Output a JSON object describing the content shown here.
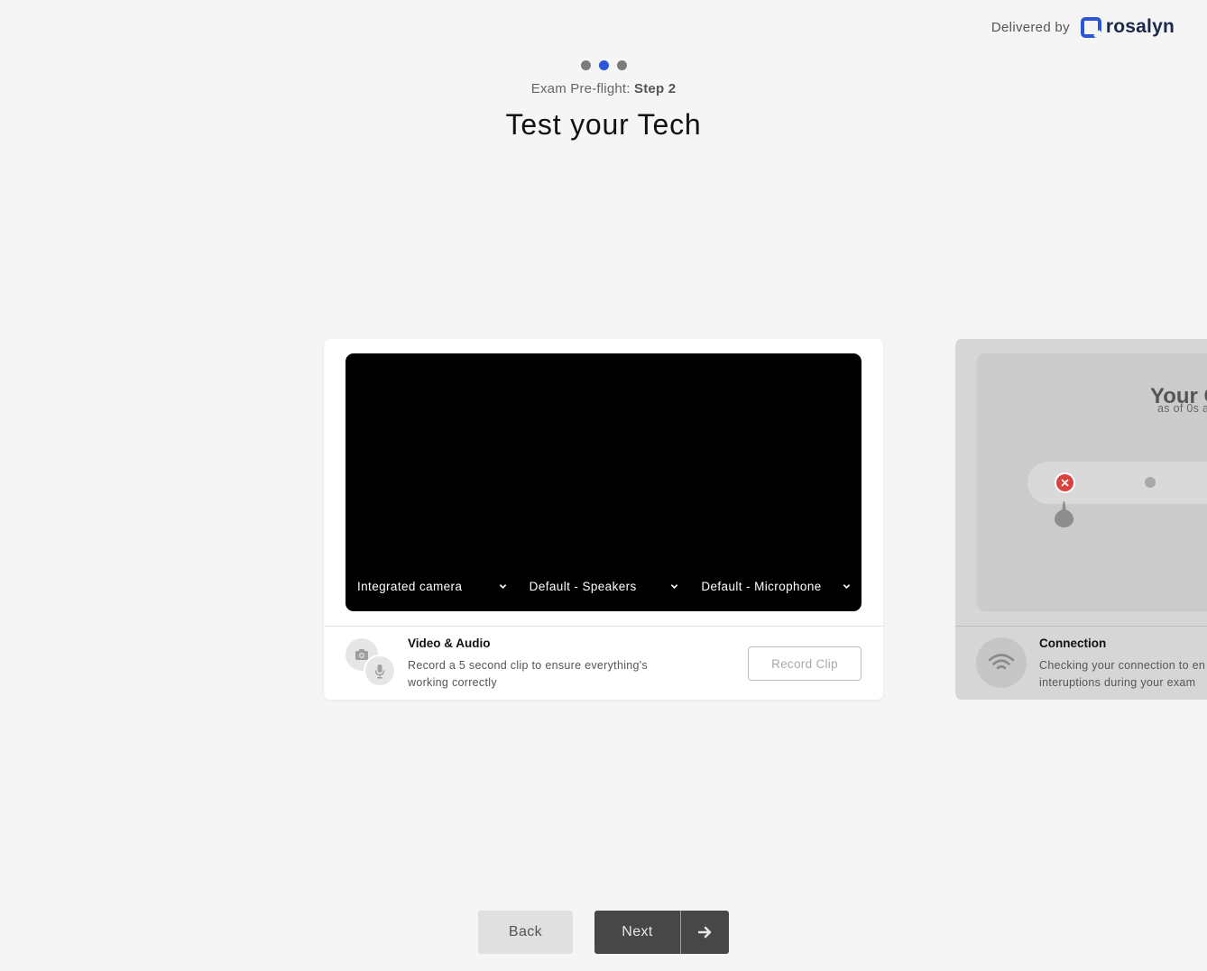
{
  "brand": {
    "delivered_by": "Delivered by",
    "name": "rosalyn"
  },
  "progress": {
    "total_steps": 3,
    "current_step": 2,
    "label_prefix": "Exam Pre-flight:",
    "label_step": "Step 2"
  },
  "page_title": "Test your Tech",
  "video_audio_card": {
    "devices": {
      "camera": "Integrated camera",
      "speakers": "Default - Speakers",
      "microphone": "Default - Microphone"
    },
    "title": "Video & Audio",
    "description": "Record a 5 second clip to ensure everything's working correctly",
    "record_button": "Record Clip"
  },
  "connection_card": {
    "title_partial": "Your C",
    "subtitle_partial": "as of 0s a",
    "status": "error",
    "feature_title": "Connection",
    "description_line1_partial": "Checking your connection to en",
    "description_line2_partial": "interuptions during your exam"
  },
  "navigation": {
    "back": "Back",
    "next": "Next"
  },
  "colors": {
    "accent": "#2a55d6",
    "error": "#d8423f",
    "background": "#f5f5f5",
    "next_button": "#474747"
  }
}
